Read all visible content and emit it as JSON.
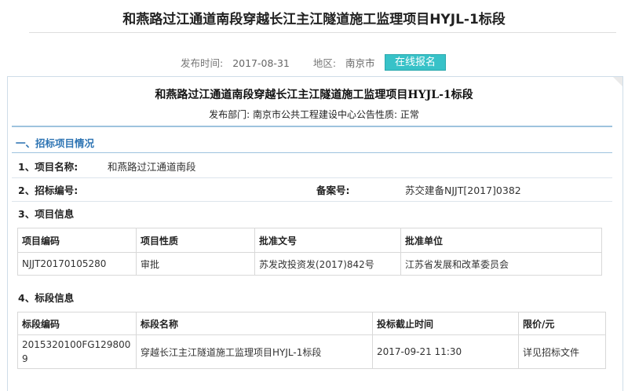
{
  "page": {
    "title": "和燕路过江通道南段穿越长江主江隧道施工监理项目HYJL-1标段"
  },
  "meta": {
    "publish_time_label": "发布时间:",
    "publish_time": "2017-08-31",
    "region_label": "地区:",
    "region": "南京市",
    "apply_button": "在线报名"
  },
  "notice": {
    "title": "和燕路过江通道南段穿越长江主江隧道施工监理项目HYJL-1标段",
    "publish_line": "发布部门: 南京市公共工程建设中心公告性质:  正常"
  },
  "section1": {
    "heading": "一、招标项目情况",
    "project_name_label": "1、项目名称:",
    "project_name": "和燕路过江通道南段",
    "tender_no_label": "2、招标编号:",
    "record_no_label": "备案号:",
    "record_no": "苏交建备NJJT[2017]0382",
    "project_info_label": "3、项目信息",
    "section_info_label": "4、标段信息"
  },
  "project_table": {
    "headers": [
      "项目编码",
      "项目性质",
      "批准文号",
      "批准单位"
    ],
    "rows": [
      [
        "NJJT20170105280",
        "审批",
        "苏发改投资发(2017)842号",
        "江苏省发展和改革委员会"
      ]
    ]
  },
  "section_table": {
    "headers": [
      "标段编码",
      "标段名称",
      "投标截止时间",
      "限价/元"
    ],
    "rows": [
      [
        "2015320100FG1298009",
        "穿越长江主江隧道施工监理项目HYJL-1标段",
        "2017-09-21 11:30",
        "详见招标文件"
      ]
    ]
  },
  "colors": {
    "accent": "#2d74b3",
    "button": "#37c2c8",
    "rule": "#9ec3de"
  }
}
